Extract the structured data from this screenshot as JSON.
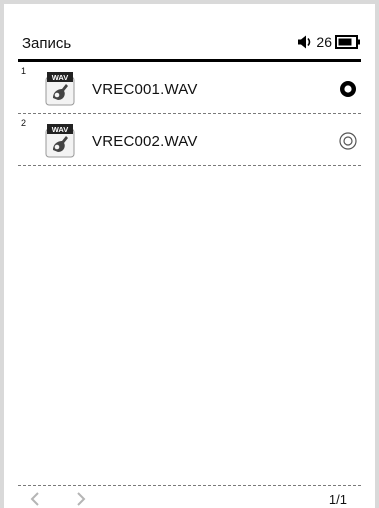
{
  "header": {
    "title": "Запись",
    "volume": "26"
  },
  "files": [
    {
      "index": "1",
      "name": "VREC001.WAV",
      "icon_badge": "WAV",
      "selected": true
    },
    {
      "index": "2",
      "name": "VREC002.WAV",
      "icon_badge": "WAV",
      "selected": false
    }
  ],
  "footer": {
    "page": "1/1"
  },
  "icons": {
    "volume": "speaker-icon",
    "battery": "battery-icon",
    "file": "wav-file-icon",
    "prev": "chevron-left-icon",
    "next": "chevron-right-icon"
  }
}
